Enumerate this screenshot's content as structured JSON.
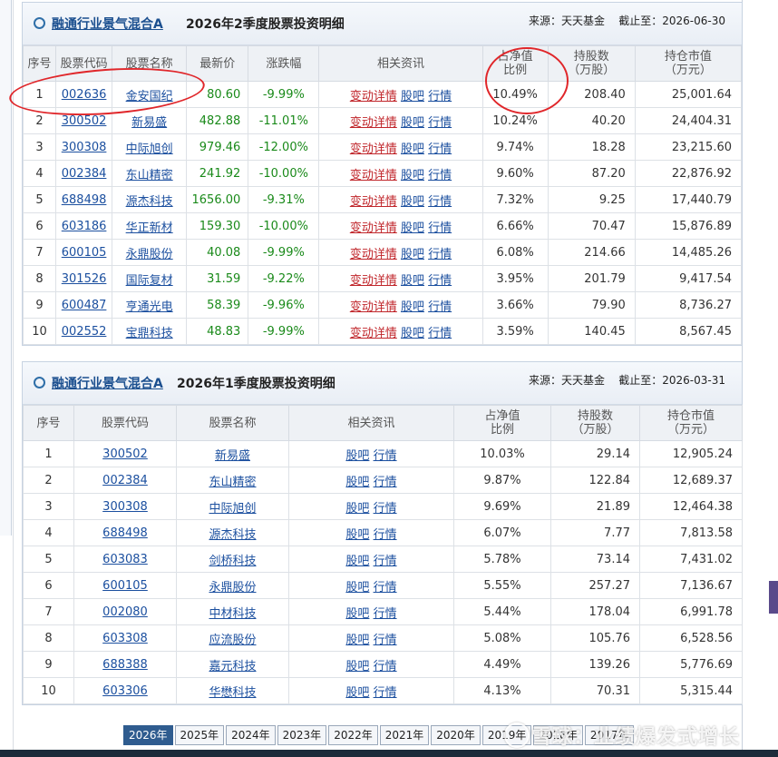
{
  "panel1": {
    "fund_name": "融通行业景气混合A",
    "subtitle": "2026年2季度股票投资明细",
    "source_label": "来源：天天基金",
    "deadline_label": "截止至：2026-06-30",
    "headers": [
      "序号",
      "股票代码",
      "股票名称",
      "最新价",
      "涨跌幅",
      "相关资讯",
      "占净值\n比例",
      "持股数\n（万股）",
      "持仓市值\n（万元）"
    ],
    "news_links": [
      "变动详情",
      "股吧",
      "行情"
    ],
    "rows": [
      {
        "no": "1",
        "code": "002636",
        "name": "金安国纪",
        "price": "80.60",
        "change": "-9.99%",
        "ratio": "10.49%",
        "shares": "208.40",
        "value": "25,001.64"
      },
      {
        "no": "2",
        "code": "300502",
        "name": "新易盛",
        "price": "482.88",
        "change": "-11.01%",
        "ratio": "10.24%",
        "shares": "40.20",
        "value": "24,404.31"
      },
      {
        "no": "3",
        "code": "300308",
        "name": "中际旭创",
        "price": "979.46",
        "change": "-12.00%",
        "ratio": "9.74%",
        "shares": "18.28",
        "value": "23,215.60"
      },
      {
        "no": "4",
        "code": "002384",
        "name": "东山精密",
        "price": "241.92",
        "change": "-10.00%",
        "ratio": "9.60%",
        "shares": "87.20",
        "value": "22,876.92"
      },
      {
        "no": "5",
        "code": "688498",
        "name": "源杰科技",
        "price": "1656.00",
        "change": "-9.31%",
        "ratio": "7.32%",
        "shares": "9.25",
        "value": "17,440.79"
      },
      {
        "no": "6",
        "code": "603186",
        "name": "华正新材",
        "price": "159.30",
        "change": "-10.00%",
        "ratio": "6.66%",
        "shares": "70.47",
        "value": "15,876.89"
      },
      {
        "no": "7",
        "code": "600105",
        "name": "永鼎股份",
        "price": "40.08",
        "change": "-9.99%",
        "ratio": "6.08%",
        "shares": "214.66",
        "value": "14,485.26"
      },
      {
        "no": "8",
        "code": "301526",
        "name": "国际复材",
        "price": "31.59",
        "change": "-9.22%",
        "ratio": "3.95%",
        "shares": "201.79",
        "value": "9,417.54"
      },
      {
        "no": "9",
        "code": "600487",
        "name": "亨通光电",
        "price": "58.39",
        "change": "-9.96%",
        "ratio": "3.66%",
        "shares": "79.90",
        "value": "8,736.27"
      },
      {
        "no": "10",
        "code": "002552",
        "name": "宝鼎科技",
        "price": "48.83",
        "change": "-9.99%",
        "ratio": "3.59%",
        "shares": "140.45",
        "value": "8,567.45"
      }
    ]
  },
  "panel2": {
    "fund_name": "融通行业景气混合A",
    "subtitle": "2026年1季度股票投资明细",
    "source_label": "来源：天天基金",
    "deadline_label": "截止至：2026-03-31",
    "headers": [
      "序号",
      "股票代码",
      "股票名称",
      "相关资讯",
      "占净值\n比例",
      "持股数\n（万股）",
      "持仓市值\n（万元）"
    ],
    "news_links": [
      "股吧",
      "行情"
    ],
    "rows": [
      {
        "no": "1",
        "code": "300502",
        "name": "新易盛",
        "ratio": "10.03%",
        "shares": "29.14",
        "value": "12,905.24"
      },
      {
        "no": "2",
        "code": "002384",
        "name": "东山精密",
        "ratio": "9.87%",
        "shares": "122.84",
        "value": "12,689.37"
      },
      {
        "no": "3",
        "code": "300308",
        "name": "中际旭创",
        "ratio": "9.69%",
        "shares": "21.89",
        "value": "12,464.38"
      },
      {
        "no": "4",
        "code": "688498",
        "name": "源杰科技",
        "ratio": "6.07%",
        "shares": "7.77",
        "value": "7,813.58"
      },
      {
        "no": "5",
        "code": "603083",
        "name": "剑桥科技",
        "ratio": "5.78%",
        "shares": "73.14",
        "value": "7,431.02"
      },
      {
        "no": "6",
        "code": "600105",
        "name": "永鼎股份",
        "ratio": "5.55%",
        "shares": "257.27",
        "value": "7,136.67"
      },
      {
        "no": "7",
        "code": "002080",
        "name": "中材科技",
        "ratio": "5.44%",
        "shares": "178.04",
        "value": "6,991.78"
      },
      {
        "no": "8",
        "code": "603308",
        "name": "应流股份",
        "ratio": "5.08%",
        "shares": "105.76",
        "value": "6,528.56"
      },
      {
        "no": "9",
        "code": "688388",
        "name": "嘉元科技",
        "ratio": "4.49%",
        "shares": "139.26",
        "value": "5,776.69"
      },
      {
        "no": "10",
        "code": "603306",
        "name": "华懋科技",
        "ratio": "4.13%",
        "shares": "70.31",
        "value": "5,315.44"
      }
    ]
  },
  "year_tabs": [
    "2026年",
    "2025年",
    "2024年",
    "2023年",
    "2022年",
    "2021年",
    "2020年",
    "2019年",
    "2018年",
    "2017年"
  ],
  "active_year": "2026年",
  "watermark": "雪球：业绩爆发式增长",
  "colors": {
    "link": "#1b4f9f",
    "negative": "#1a8a1a",
    "news_red": "#c0262b",
    "annotation": "#e0262a",
    "active_tab": "#2f5c8f"
  }
}
